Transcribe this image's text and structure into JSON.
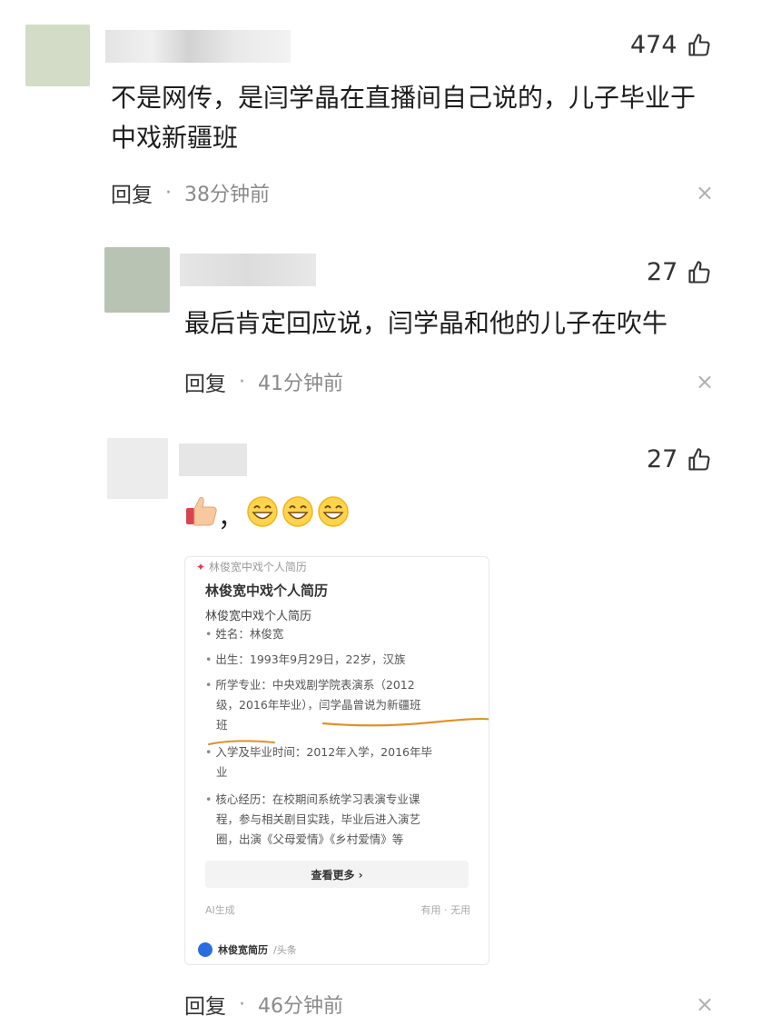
{
  "comments": [
    {
      "likes": "474",
      "text_line1": "不是网传，是闫学晶在直播间自己说的，儿子毕业于",
      "text_line2": "中戏新疆班",
      "reply_label": "回复",
      "separator": "·",
      "time": "38分钟前",
      "close": "×"
    },
    {
      "likes": "27",
      "text_line1": "最后肯定回应说，闫学晶和他的儿子在吹牛",
      "reply_label": "回复",
      "separator": "·",
      "time": "41分钟前",
      "close": "×"
    },
    {
      "likes": "27",
      "comma": "，",
      "reply_label": "回复",
      "separator": "·",
      "time": "46分钟前",
      "close": "×"
    }
  ],
  "card": {
    "top_text": "林俊宽中戏个人简历",
    "title": "林俊宽中戏个人简历",
    "subtitle": "林俊宽中戏个人简历",
    "lines": [
      "姓名：林俊宽",
      "出生：1993年9月29日，22岁，汉族",
      "所学专业：中央戏剧学院表演系（2012",
      "级，2016年毕业），闫学晶曾说为新疆班",
      "班",
      "入学及毕业时间：2012年入学，2016年毕",
      "业",
      "核心经历：在校期间系统学习表演专业课",
      "程，参与相关剧目实践，毕业后进入演艺",
      "圈，出演《父母爱情》《乡村爱情》等"
    ],
    "more_button": "查看更多 ›",
    "footer_left": "AI生成",
    "footer_right": "有用 · 无用",
    "brand": "林俊宽简历",
    "brand_suffix": "/头条"
  },
  "colors": {
    "highlight_underline": "#e0902a",
    "like_icon": "#333333"
  }
}
